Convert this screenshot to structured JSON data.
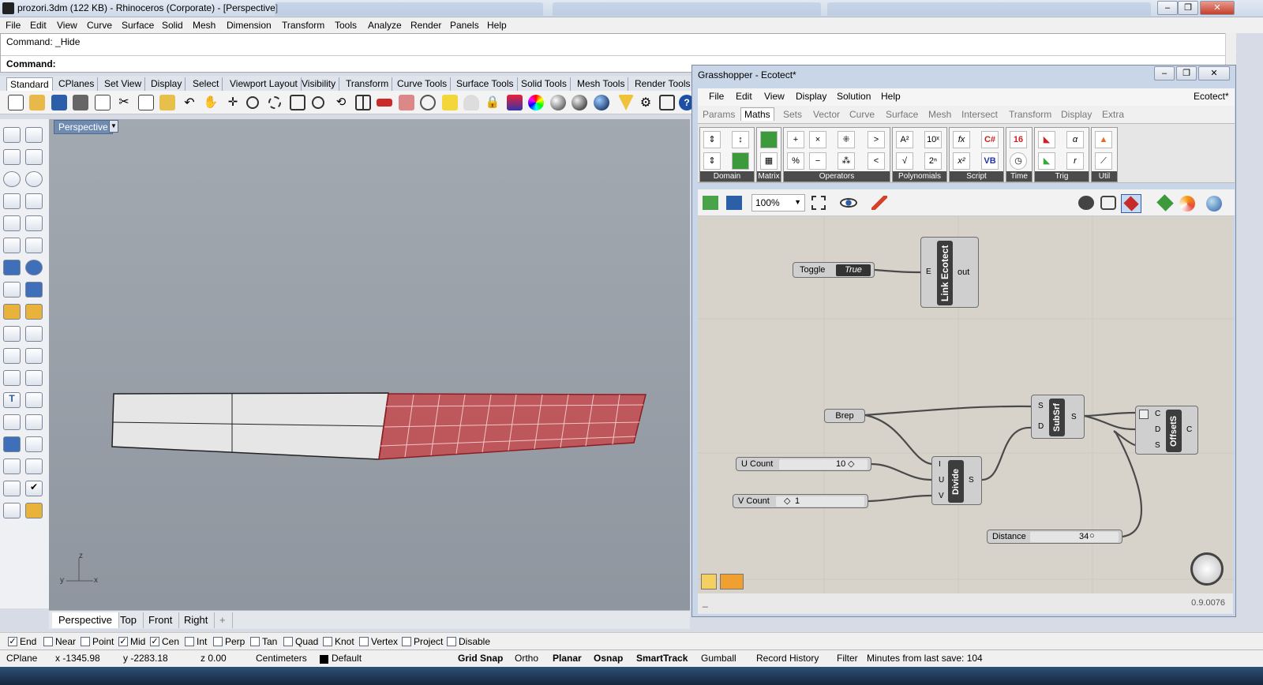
{
  "window": {
    "title": "prozori.3dm (122 KB) - Rhinoceros (Corporate) - [Perspective]"
  },
  "menu": [
    "File",
    "Edit",
    "View",
    "Curve",
    "Surface",
    "Solid",
    "Mesh",
    "Dimension",
    "Transform",
    "Tools",
    "Analyze",
    "Render",
    "Panels",
    "Help"
  ],
  "command": {
    "history": "Command: _Hide",
    "prompt": "Command:"
  },
  "toolbar_tabs": [
    "Standard",
    "CPlanes",
    "Set View",
    "Display",
    "Select",
    "Viewport Layout",
    "Visibility",
    "Transform",
    "Curve Tools",
    "Surface Tools",
    "Solid Tools",
    "Mesh Tools",
    "Render Tools"
  ],
  "viewport": {
    "title": "Perspective",
    "axis_z": "z",
    "axis_y": "y",
    "axis_x": "x"
  },
  "viewport_tabs": [
    "Perspective",
    "Top",
    "Front",
    "Right",
    "+"
  ],
  "osnap": [
    {
      "label": "End",
      "checked": true
    },
    {
      "label": "Near",
      "checked": false
    },
    {
      "label": "Point",
      "checked": false
    },
    {
      "label": "Mid",
      "checked": true
    },
    {
      "label": "Cen",
      "checked": true
    },
    {
      "label": "Int",
      "checked": false
    },
    {
      "label": "Perp",
      "checked": false
    },
    {
      "label": "Tan",
      "checked": false
    },
    {
      "label": "Quad",
      "checked": false
    },
    {
      "label": "Knot",
      "checked": false
    },
    {
      "label": "Vertex",
      "checked": false
    },
    {
      "label": "Project",
      "checked": false
    },
    {
      "label": "Disable",
      "checked": false
    }
  ],
  "status": {
    "cplane": "CPlane",
    "x": "x -1345.98",
    "y": "y -2283.18",
    "z": "z 0.00",
    "units": "Centimeters",
    "layer": "Default",
    "grid_snap": "Grid Snap",
    "ortho": "Ortho",
    "planar": "Planar",
    "osnap": "Osnap",
    "smarttrack": "SmartTrack",
    "gumball": "Gumball",
    "record_history": "Record History",
    "filter": "Filter",
    "minutes": "Minutes from last save: 104"
  },
  "grasshopper": {
    "title": "Grasshopper - Ecotect*",
    "menu": [
      "File",
      "Edit",
      "View",
      "Display",
      "Solution",
      "Help"
    ],
    "doc_name": "Ecotect*",
    "tabs": [
      "Params",
      "Maths",
      "Sets",
      "Vector",
      "Curve",
      "Surface",
      "Mesh",
      "Intersect",
      "Transform",
      "Display",
      "Extra"
    ],
    "active_tab": "Maths",
    "groups": [
      "Domain",
      "Matrix",
      "Operators",
      "Polynomials",
      "Script",
      "Time",
      "Trig",
      "Util"
    ],
    "zoom": "100%",
    "version": "0.9.0076",
    "footer_left": "_",
    "nodes": {
      "toggle_label": "Toggle",
      "toggle_value": "True",
      "link_ecotect": "Link Ecotect",
      "link_in": "E",
      "link_out": "out",
      "brep": "Brep",
      "subsrf": "SubSrf",
      "subsrf_s": "S",
      "subsrf_d": "D",
      "subsrf_out": "S",
      "offsets": "OffsetS",
      "offsets_c": "C",
      "offsets_d": "D",
      "offsets_s": "S",
      "offsets_out": "C",
      "u_count_label": "U Count",
      "u_count_value": "10",
      "v_count_label": "V Count",
      "v_count_value": "1",
      "divide": "Divide",
      "divide_i": "I",
      "divide_u": "U",
      "divide_v": "V",
      "divide_out": "S",
      "distance_label": "Distance",
      "distance_value": "34"
    }
  },
  "colors": {
    "accent": "#6f8bb0",
    "selection": "#c8464a",
    "viewport_bg": "#9aa1aa",
    "gh_canvas": "#d7d3cb"
  }
}
